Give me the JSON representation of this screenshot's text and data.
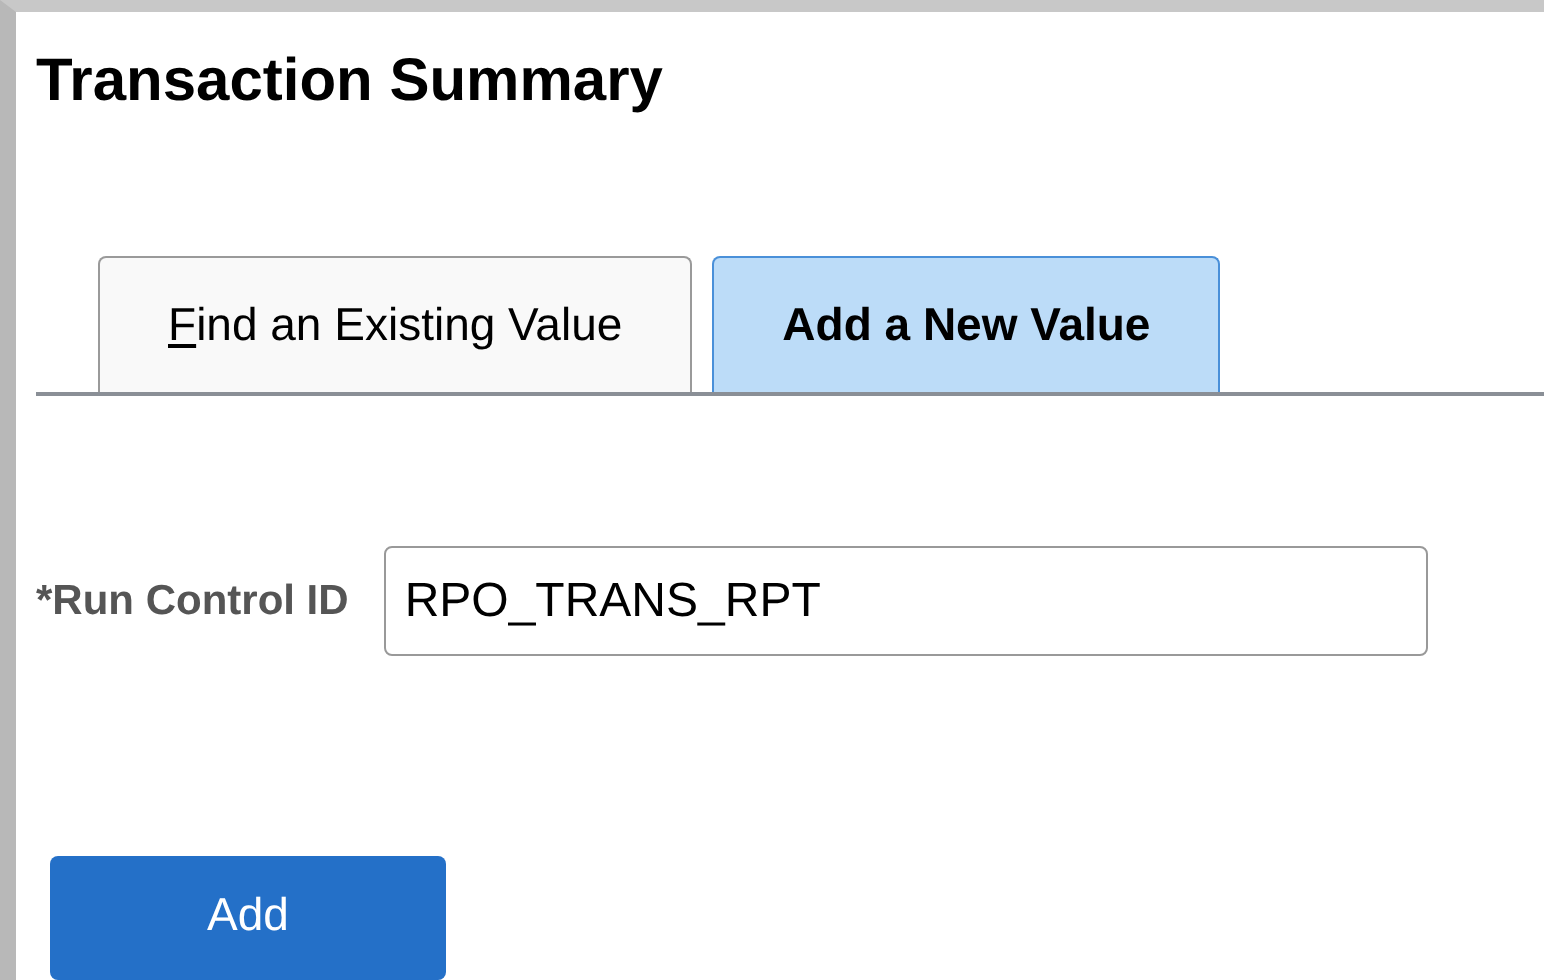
{
  "page": {
    "title": "Transaction Summary"
  },
  "tabs": [
    {
      "label": "Find an Existing Value",
      "selected": false,
      "access_key_underlined": true
    },
    {
      "label": "Add a New Value",
      "selected": true,
      "access_key_underlined": false
    }
  ],
  "form": {
    "field_label": "*Run Control ID",
    "value": "RPO_TRANS_RPT"
  },
  "buttons": [
    {
      "label": "Add"
    }
  ]
}
